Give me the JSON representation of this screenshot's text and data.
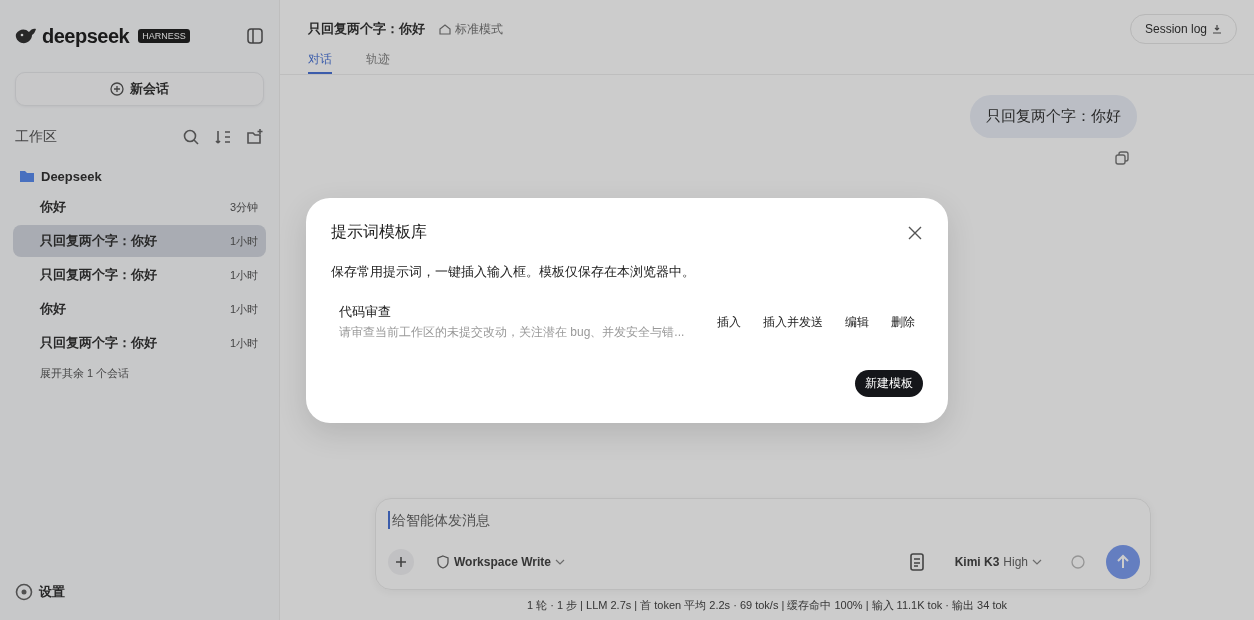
{
  "sidebar": {
    "brand": "deepseek",
    "badge": "HARNESS",
    "new_chat": "新会话",
    "section": "工作区",
    "folder": "Deepseek",
    "sessions": [
      {
        "title": "你好",
        "time": "3分钟",
        "selected": false
      },
      {
        "title": "只回复两个字：你好",
        "time": "1小时",
        "selected": true
      },
      {
        "title": "只回复两个字：你好",
        "time": "1小时",
        "selected": false
      },
      {
        "title": "你好",
        "time": "1小时",
        "selected": false
      },
      {
        "title": "只回复两个字：你好",
        "time": "1小时",
        "selected": false
      }
    ],
    "more": "展开其余 1 个会话",
    "settings": "设置"
  },
  "main": {
    "title": "只回复两个字：你好",
    "mode": "标准模式",
    "session_log": "Session log",
    "tabs": [
      {
        "label": "对话",
        "selected": true
      },
      {
        "label": "轨迹",
        "selected": false
      }
    ],
    "user_message": "只回复两个字：你好",
    "composer": {
      "placeholder": "给智能体发消息",
      "permission": "Workspace Write",
      "model": "Kimi K3",
      "effort": "High"
    },
    "status_bar": "1 轮 · 1 步 | LLM 2.7s | 首 token 平均 2.2s · 69 tok/s | 缓存命中 100% | 输入 11.1K tok · 输出 34 tok"
  },
  "dialog": {
    "title": "提示词模板库",
    "description": "保存常用提示词，一键插入输入框。模板仅保存在本浏览器中。",
    "templates": [
      {
        "name": "代码审查",
        "preview": "请审查当前工作区的未提交改动，关注潜在 bug、并发安全与错...",
        "actions": [
          "插入",
          "插入并发送",
          "编辑",
          "删除"
        ]
      }
    ],
    "new_button": "新建模板"
  }
}
